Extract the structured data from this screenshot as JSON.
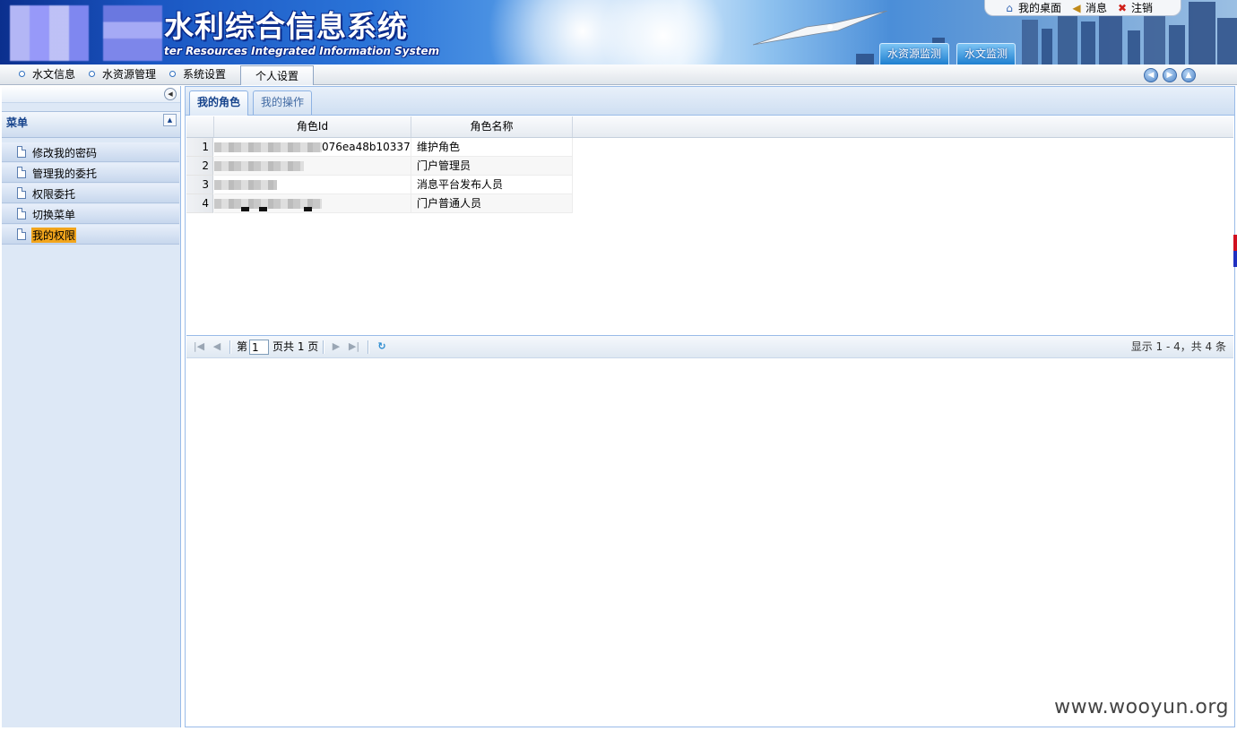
{
  "banner": {
    "title": "水利综合信息系统",
    "subtitle": "ter Resources Integrated Information System",
    "top_links": [
      {
        "label": "我的桌面",
        "icon": "home-icon"
      },
      {
        "label": "消息",
        "icon": "speaker-icon"
      },
      {
        "label": "注销",
        "icon": "close-icon"
      }
    ],
    "shortcuts": [
      "水资源监测",
      "水文监测"
    ]
  },
  "topnav": {
    "items": [
      "水文信息",
      "水资源管理",
      "系统设置",
      "个人设置"
    ],
    "active": "个人设置"
  },
  "left_panel": {
    "menu_title": "菜单",
    "items": [
      "修改我的密码",
      "管理我的委托",
      "权限委托",
      "切换菜单",
      "我的权限"
    ],
    "selected": "我的权限"
  },
  "main": {
    "tabs": [
      {
        "label": "我的角色",
        "active": true
      },
      {
        "label": "我的操作",
        "active": false
      }
    ],
    "grid": {
      "columns": [
        "角色Id",
        "角色名称"
      ],
      "rows": [
        {
          "num": "1",
          "id_visible": "076ea48b10337",
          "name": "维护角色"
        },
        {
          "num": "2",
          "id_visible": "",
          "name": "门户管理员"
        },
        {
          "num": "3",
          "id_visible": "",
          "name": "消息平台发布人员"
        },
        {
          "num": "4",
          "id_visible": "",
          "name": "门户普通人员"
        }
      ]
    },
    "pager": {
      "before_input": "第",
      "page_value": "1",
      "after_input": "页共 1 页",
      "display_info": "显示 1 - 4，共 4 条"
    }
  },
  "watermark": "www.wooyun.org"
}
